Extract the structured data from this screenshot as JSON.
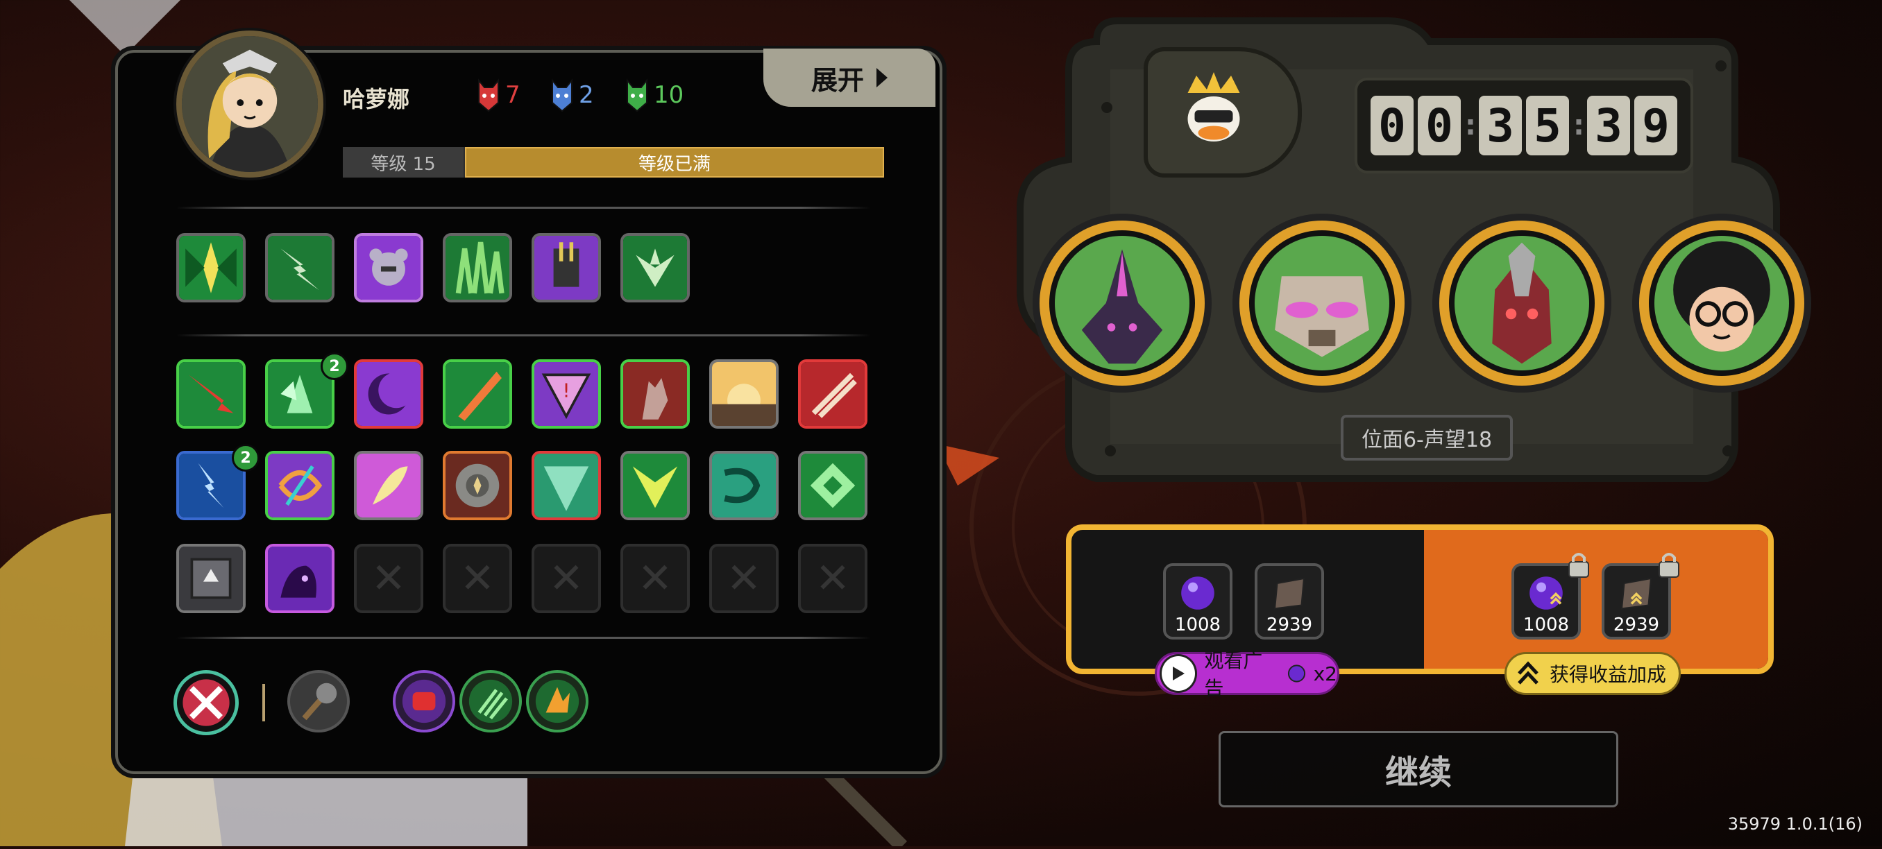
{
  "hero": {
    "name": "哈萝娜",
    "level_label": "等级 15",
    "level_status": "等级已满",
    "stats": [
      {
        "icon": "red-mask-icon",
        "value": "7",
        "color": "#e04040"
      },
      {
        "icon": "blue-mask-icon",
        "value": "2",
        "color": "#6fa0e6"
      },
      {
        "icon": "green-mask-icon",
        "value": "10",
        "color": "#5cc85c"
      }
    ]
  },
  "expand_button": {
    "label": "展开"
  },
  "equipment_slots": [
    "green-crest-icon",
    "lightning-burst-icon",
    "purple-bubble-icon",
    "green-flames-icon",
    "purple-machine-icon",
    "green-leaf-icon"
  ],
  "skill_grid": {
    "row1": [
      {
        "icon": "red-arrow-icon",
        "frame": "green"
      },
      {
        "icon": "green-crystal-icon",
        "frame": "green",
        "badge": "2"
      },
      {
        "icon": "purple-crescent-icon",
        "frame": "red"
      },
      {
        "icon": "fire-sword-icon",
        "frame": "green"
      },
      {
        "icon": "purple-triangle-icon",
        "frame": "green"
      },
      {
        "icon": "red-hand-icon",
        "frame": "green"
      },
      {
        "icon": "sunrise-icon",
        "frame": "grey"
      },
      {
        "icon": "red-slash-icon",
        "frame": "red"
      }
    ],
    "row2": [
      {
        "icon": "blue-lightning-icon",
        "frame": "blue",
        "badge": "2"
      },
      {
        "icon": "purple-bow-icon",
        "frame": "green"
      },
      {
        "icon": "pink-feather-icon",
        "frame": "grey"
      },
      {
        "icon": "bronze-shield-icon",
        "frame": "orange"
      },
      {
        "icon": "teal-claw-icon",
        "frame": "red"
      },
      {
        "icon": "green-v-icon",
        "frame": "grey"
      },
      {
        "icon": "teal-swirl-icon",
        "frame": "grey"
      },
      {
        "icon": "green-diamond-icon",
        "frame": "grey"
      }
    ],
    "row3": [
      {
        "icon": "grey-chest-icon",
        "frame": "grey"
      },
      {
        "icon": "purple-beast-icon",
        "frame": "purple"
      }
    ],
    "empty_slots": 6
  },
  "abilities": [
    "crossed-swords-icon",
    "mace-icon",
    "fist-icon",
    "green-claws-icon",
    "fire-burst-icon"
  ],
  "timer": {
    "digits": [
      "0",
      "0",
      "3",
      "5",
      "3",
      "9"
    ]
  },
  "king_icon": "crowned-duck-icon",
  "team_heroes": [
    "purple-knight-icon",
    "masked-robot-icon",
    "red-beast-icon",
    "afro-glasses-icon"
  ],
  "plane_label": "位面6-声望18",
  "rewards": {
    "base": [
      {
        "icon": "purple-orb-icon",
        "value": "1008"
      },
      {
        "icon": "book-icon",
        "value": "2939"
      }
    ],
    "boosted": [
      {
        "icon": "purple-orb-icon",
        "value": "1008"
      },
      {
        "icon": "book-icon",
        "value": "2939"
      }
    ]
  },
  "ad_button": {
    "label": "观看广告",
    "multiplier": "x2"
  },
  "bonus_button": {
    "label": "获得收益加成"
  },
  "continue_button": {
    "label": "继续"
  },
  "version": "35979 1.0.1(16)"
}
